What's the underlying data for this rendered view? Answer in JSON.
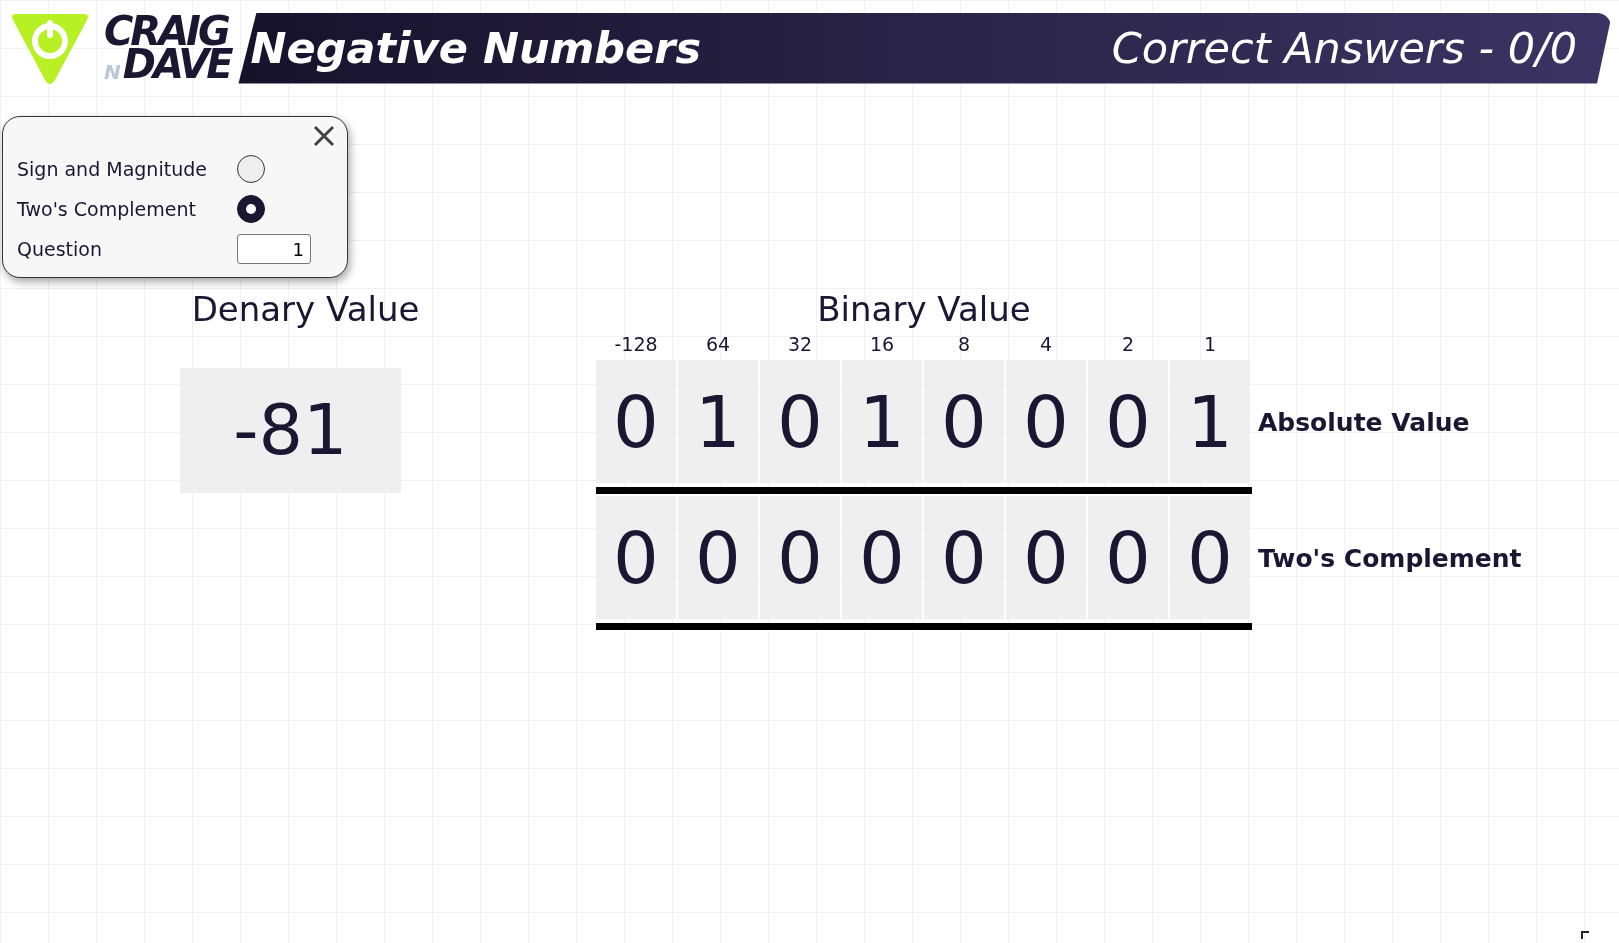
{
  "logo": {
    "top": "CRAIG",
    "joiner": "N",
    "bottom": "DAVE"
  },
  "header": {
    "title": "Negative Numbers",
    "score": "Correct Answers - 0/0"
  },
  "settings": {
    "options": [
      {
        "label": "Sign and Magnitude",
        "selected": false
      },
      {
        "label": "Two's Complement",
        "selected": true
      }
    ],
    "question": {
      "label": "Question",
      "value": "1"
    }
  },
  "denary": {
    "label": "Denary Value",
    "value": "-81"
  },
  "binary": {
    "label": "Binary Value",
    "weights": [
      "-128",
      "64",
      "32",
      "16",
      "8",
      "4",
      "2",
      "1"
    ],
    "rows": [
      {
        "label": "Absolute Value",
        "bits": [
          "0",
          "1",
          "0",
          "1",
          "0",
          "0",
          "0",
          "1"
        ]
      },
      {
        "label": "Two's Complement",
        "bits": [
          "0",
          "0",
          "0",
          "0",
          "0",
          "0",
          "0",
          "0"
        ]
      }
    ]
  }
}
